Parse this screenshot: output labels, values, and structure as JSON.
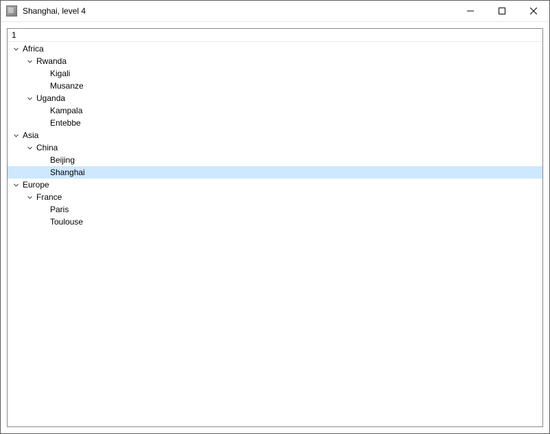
{
  "window": {
    "title": "Shanghai, level 4"
  },
  "tree": {
    "header": "1",
    "selected_path": "asia.china.shanghai",
    "nodes": [
      {
        "id": "africa",
        "label": "Africa",
        "expanded": true,
        "children": [
          {
            "id": "rwanda",
            "label": "Rwanda",
            "expanded": true,
            "children": [
              {
                "id": "kigali",
                "label": "Kigali"
              },
              {
                "id": "musanze",
                "label": "Musanze"
              }
            ]
          },
          {
            "id": "uganda",
            "label": "Uganda",
            "expanded": true,
            "children": [
              {
                "id": "kampala",
                "label": "Kampala"
              },
              {
                "id": "entebbe",
                "label": "Entebbe"
              }
            ]
          }
        ]
      },
      {
        "id": "asia",
        "label": "Asia",
        "expanded": true,
        "children": [
          {
            "id": "china",
            "label": "China",
            "expanded": true,
            "children": [
              {
                "id": "beijing",
                "label": "Beijing"
              },
              {
                "id": "shanghai",
                "label": "Shanghai"
              }
            ]
          }
        ]
      },
      {
        "id": "europe",
        "label": "Europe",
        "expanded": true,
        "children": [
          {
            "id": "france",
            "label": "France",
            "expanded": true,
            "children": [
              {
                "id": "paris",
                "label": "Paris"
              },
              {
                "id": "toulouse",
                "label": "Toulouse"
              }
            ]
          }
        ]
      }
    ]
  }
}
